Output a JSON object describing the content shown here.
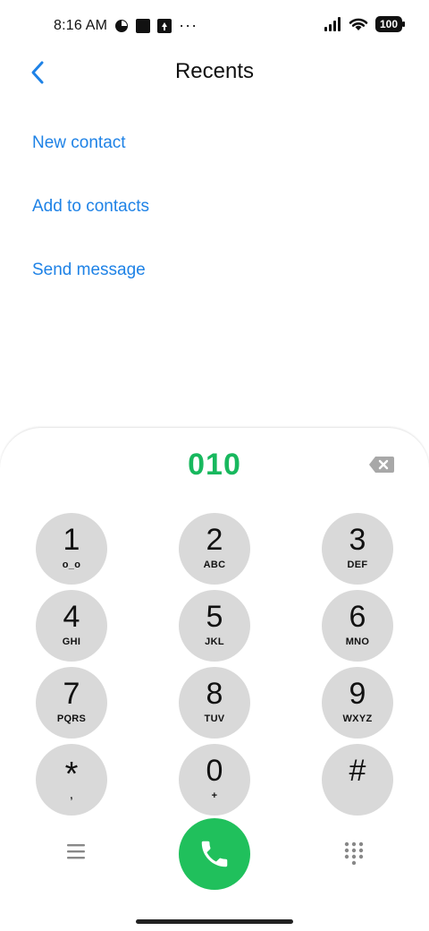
{
  "status_bar": {
    "time": "8:16 AM",
    "battery": "100",
    "icons": [
      "pie-status-icon",
      "square-notification-icon",
      "upload-notification-icon",
      "more-dots-icon",
      "signal-icon",
      "wifi-icon",
      "battery-icon"
    ],
    "dots": "···"
  },
  "header": {
    "title": "Recents",
    "back_icon": "chevron-left-icon"
  },
  "actions": [
    {
      "label": "New contact"
    },
    {
      "label": "Add to contacts"
    },
    {
      "label": "Send message"
    }
  ],
  "dialer": {
    "number": "010",
    "number_color": "#18b85e",
    "keys": [
      {
        "digit": "1",
        "letters": "o_o"
      },
      {
        "digit": "2",
        "letters": "ABC"
      },
      {
        "digit": "3",
        "letters": "DEF"
      },
      {
        "digit": "4",
        "letters": "GHI"
      },
      {
        "digit": "5",
        "letters": "JKL"
      },
      {
        "digit": "6",
        "letters": "MNO"
      },
      {
        "digit": "7",
        "letters": "PQRS"
      },
      {
        "digit": "8",
        "letters": "TUV"
      },
      {
        "digit": "9",
        "letters": "WXYZ"
      },
      {
        "digit": "*",
        "letters": ","
      },
      {
        "digit": "0",
        "letters": "+"
      },
      {
        "digit": "#",
        "letters": ""
      }
    ]
  },
  "colors": {
    "accent": "#1e82e6",
    "call_green": "#20c05c",
    "key_bg": "#d9d9d9"
  }
}
